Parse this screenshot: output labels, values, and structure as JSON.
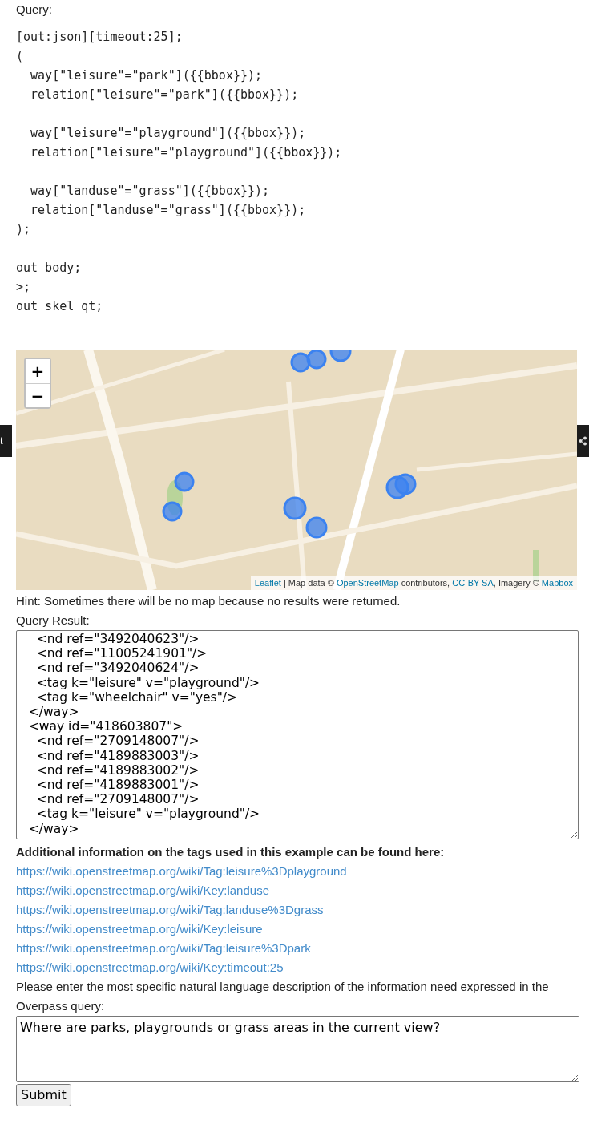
{
  "query_label": "Query:",
  "query_code": "[out:json][timeout:25];\n(\n  way[\"leisure\"=\"park\"]({{bbox}});\n  relation[\"leisure\"=\"park\"]({{bbox}});\n\n  way[\"leisure\"=\"playground\"]({{bbox}});\n  relation[\"leisure\"=\"playground\"]({{bbox}});\n\n  way[\"landuse\"=\"grass\"]({{bbox}});\n  relation[\"landuse\"=\"grass\"]({{bbox}});\n);\n\nout body;\n>;\nout skel qt;",
  "map": {
    "zoom_in": "+",
    "zoom_out": "−",
    "attribution": [
      {
        "text": "Leaflet",
        "link": true
      },
      {
        "text": " | Map data © ",
        "link": false
      },
      {
        "text": "OpenStreetMap",
        "link": true
      },
      {
        "text": " contributors, ",
        "link": false
      },
      {
        "text": "CC-BY-SA",
        "link": true
      },
      {
        "text": ", Imagery © ",
        "link": false
      },
      {
        "text": "Mapbox",
        "link": true
      }
    ]
  },
  "side_tab_left": "t",
  "hint": "Hint: Sometimes there will be no map because no results were returned.",
  "result_label": "Query Result:",
  "result_text": "    <nd ref=\"3492040623\"/>\n    <nd ref=\"11005241901\"/>\n    <nd ref=\"3492040624\"/>\n    <tag k=\"leisure\" v=\"playground\"/>\n    <tag k=\"wheelchair\" v=\"yes\"/>\n  </way>\n  <way id=\"418603807\">\n    <nd ref=\"2709148007\"/>\n    <nd ref=\"4189883003\"/>\n    <nd ref=\"4189883002\"/>\n    <nd ref=\"4189883001\"/>\n    <nd ref=\"2709148007\"/>\n    <tag k=\"leisure\" v=\"playground\"/>\n  </way>",
  "info_heading": "Additional information on the tags used in this example can be found here:",
  "links": [
    "https://wiki.openstreetmap.org/wiki/Tag:leisure%3Dplayground",
    "https://wiki.openstreetmap.org/wiki/Key:landuse",
    "https://wiki.openstreetmap.org/wiki/Tag:landuse%3Dgrass",
    "https://wiki.openstreetmap.org/wiki/Key:leisure",
    "https://wiki.openstreetmap.org/wiki/Tag:leisure%3Dpark",
    "https://wiki.openstreetmap.org/wiki/Key:timeout:25"
  ],
  "prompt": "Please enter the most specific natural language description of the information need expressed in the Overpass query:",
  "answer": "Where are parks, playgrounds or grass areas in the current view?",
  "submit": "Submit"
}
